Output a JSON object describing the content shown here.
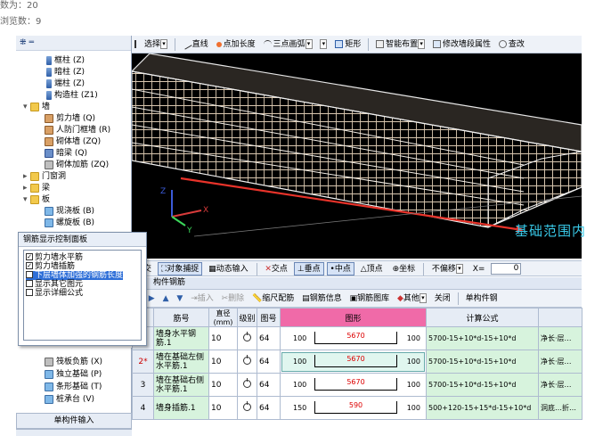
{
  "meta": {
    "favorites": "数为：20",
    "views": "浏览数：9"
  },
  "tree_toolbar": {
    "icon": "tree-expand-collapse"
  },
  "tree": [
    {
      "label": "框柱 (Z)",
      "icon": "column-icon",
      "indent": 2
    },
    {
      "label": "暗柱 (Z)",
      "icon": "column-icon",
      "indent": 2
    },
    {
      "label": "端柱 (Z)",
      "icon": "column-icon",
      "indent": 2
    },
    {
      "label": "构造柱 (Z1)",
      "icon": "column-icon",
      "indent": 2
    },
    {
      "label": "墙",
      "icon": "folder-icon",
      "indent": 1,
      "expander": "⊟"
    },
    {
      "label": "剪力墙 (Q)",
      "icon": "wall-icon",
      "indent": 2
    },
    {
      "label": "人防门框墙 (R)",
      "icon": "wall-icon",
      "indent": 2
    },
    {
      "label": "砌体墙 (ZQ)",
      "icon": "wall-icon",
      "indent": 2
    },
    {
      "label": "暗梁 (Q)",
      "icon": "beam-icon",
      "indent": 2
    },
    {
      "label": "砌体加筋 (ZQ)",
      "icon": "rebar-icon",
      "indent": 2
    },
    {
      "label": "门窗洞",
      "icon": "folder-icon",
      "indent": 1,
      "expander": "⊞"
    },
    {
      "label": "梁",
      "icon": "folder-icon",
      "indent": 1,
      "expander": "⊞"
    },
    {
      "label": "板",
      "icon": "folder-icon",
      "indent": 1,
      "expander": "⊟"
    },
    {
      "label": "现浇板 (B)",
      "icon": "plate-icon",
      "indent": 2
    },
    {
      "label": "螺旋板 (B)",
      "icon": "plate-icon",
      "indent": 2
    }
  ],
  "tree_lower": [
    {
      "label": "筏板负筋 (X)",
      "icon": "rebar-icon"
    },
    {
      "label": "独立基础 (P)",
      "icon": "plate-icon"
    },
    {
      "label": "条形基础 (T)",
      "icon": "plate-icon"
    },
    {
      "label": "桩承台 (V)",
      "icon": "plate-icon"
    }
  ],
  "toolbar": {
    "select": "选择",
    "line": "直线",
    "point_length": "点加长度",
    "three_point_arc": "三点画弧",
    "rect": "矩形",
    "smart_layout": "智能布置",
    "modify_segment": "修改墙段属性",
    "query": "查改"
  },
  "viewport": {
    "annotation": "基础范围内"
  },
  "snap": {
    "ortho": "正交",
    "snap_obj": "对象捕捉",
    "dyn_input": "动态输入",
    "intersection": "交点",
    "perpendicular": "垂点",
    "midpoint": "中点",
    "vertex": "顶点",
    "coordinate": "坐标",
    "offset_mode": "不偏移",
    "x_label": "X=",
    "x_value": "0"
  },
  "rebar_panel": {
    "title": "构件钢筋",
    "toolbar": {
      "insert": "插入",
      "delete": "删除",
      "scale_rebar": "缩尺配筋",
      "rebar_info": "钢筋信息",
      "rebar_library": "钢筋图库",
      "other": "其他",
      "close": "关闭",
      "unit_rebar": "单构件钢"
    },
    "columns": [
      "",
      "筋号",
      "直径(mm)",
      "级别",
      "图号",
      "图形",
      "计算公式",
      ""
    ],
    "rows": [
      {
        "num": "1",
        "name": "墙身水平钢筋.1",
        "dia": "10",
        "fig": "64",
        "left": "100",
        "len": "5670",
        "right": "100",
        "formula": "5700-15+10*d-15+10*d",
        "extra": "净长·层…"
      },
      {
        "num": "2*",
        "name": "墙在基础左侧水平筋.1",
        "dia": "10",
        "fig": "64",
        "left": "100",
        "len": "5670",
        "right": "100",
        "formula": "5700-15+10*d-15+10*d",
        "extra": "净长·层…"
      },
      {
        "num": "3",
        "name": "墙在基础右侧水平筋.1",
        "dia": "10",
        "fig": "64",
        "left": "100",
        "len": "5670",
        "right": "100",
        "formula": "5700-15+10*d-15+10*d",
        "extra": "净长·层…"
      },
      {
        "num": "4",
        "name": "墙身插筋.1",
        "dia": "10",
        "fig": "64",
        "left": "150",
        "len": "590",
        "right": "100",
        "formula": "500+120-15+15*d-15+10*d",
        "extra": "洞底…折…"
      }
    ]
  },
  "popup": {
    "title": "钢筋显示控制面板",
    "items": [
      {
        "label": "剪力墙水平筋",
        "checked": true
      },
      {
        "label": "剪力墙插筋",
        "checked": true
      },
      {
        "label": "下层墙体加强的钢筋长度",
        "checked": true,
        "highlight": true
      },
      {
        "label": "显示其它图元",
        "checked": false
      },
      {
        "label": "显示详细公式",
        "checked": false
      }
    ]
  },
  "left_button": "单构件输入"
}
